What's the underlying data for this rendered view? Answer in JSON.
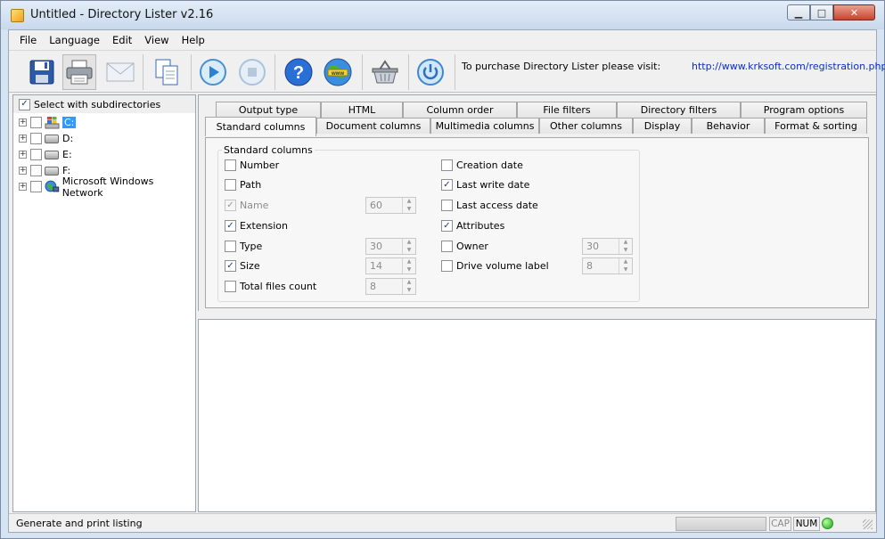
{
  "window": {
    "title": "Untitled - Directory Lister v2.16",
    "controls": {
      "minimize": "▁",
      "maximize": "□",
      "close": "✕"
    }
  },
  "menu": [
    "File",
    "Language",
    "Edit",
    "View",
    "Help"
  ],
  "toolbar": {
    "buttons": [
      {
        "name": "save",
        "icon": "floppy-disk-icon"
      },
      {
        "name": "print",
        "icon": "printer-icon"
      },
      {
        "name": "email",
        "icon": "envelope-icon"
      },
      {
        "name": "copy",
        "icon": "copy-pages-icon"
      },
      {
        "name": "start",
        "icon": "play-icon"
      },
      {
        "name": "stop",
        "icon": "stop-icon"
      },
      {
        "name": "help",
        "icon": "help-icon"
      },
      {
        "name": "website",
        "icon": "www-globe-icon"
      },
      {
        "name": "buy",
        "icon": "basket-icon"
      },
      {
        "name": "exit",
        "icon": "power-icon"
      }
    ],
    "purchase_text": "To purchase Directory Lister please visit:",
    "purchase_url": "http://www.krksoft.com/registration.php"
  },
  "tree": {
    "select_subdirs_label": "Select with subdirectories",
    "select_subdirs_checked": true,
    "items": [
      {
        "label": "C:",
        "icon": "windows-drive-icon",
        "selected": true
      },
      {
        "label": "D:",
        "icon": "drive-icon"
      },
      {
        "label": "E:",
        "icon": "drive-icon"
      },
      {
        "label": "F:",
        "icon": "drive-icon"
      },
      {
        "label": "Microsoft Windows Network",
        "icon": "network-icon"
      }
    ]
  },
  "tabs": {
    "row_back": [
      "Output type",
      "HTML",
      "Column order",
      "File filters",
      "Directory filters",
      "Program options"
    ],
    "row_front": [
      "Standard columns",
      "Document columns",
      "Multimedia columns",
      "Other columns",
      "Display",
      "Behavior",
      "Format & sorting"
    ],
    "active": "Standard columns"
  },
  "standard_columns": {
    "group_title": "Standard columns",
    "left": [
      {
        "label": "Number",
        "checked": false,
        "disabled": false
      },
      {
        "label": "Path",
        "checked": false,
        "disabled": false
      },
      {
        "label": "Name",
        "checked": true,
        "disabled": true,
        "width": "60"
      },
      {
        "label": "Extension",
        "checked": true,
        "disabled": false
      },
      {
        "label": "Type",
        "checked": false,
        "disabled": false,
        "width": "30"
      },
      {
        "label": "Size",
        "checked": true,
        "disabled": false,
        "width": "14"
      },
      {
        "label": "Total files count",
        "checked": false,
        "disabled": false,
        "width": "8"
      }
    ],
    "right": [
      {
        "label": "Creation date",
        "checked": false
      },
      {
        "label": "Last write date",
        "checked": true
      },
      {
        "label": "Last access date",
        "checked": false
      },
      {
        "label": "Attributes",
        "checked": true
      },
      {
        "label": "Owner",
        "checked": false,
        "width": "30"
      },
      {
        "label": "Drive volume label",
        "checked": false,
        "width": "8"
      }
    ]
  },
  "status": {
    "text": "Generate and print listing",
    "progress": 0,
    "cap": "CAP",
    "num": "NUM",
    "led_color": "#1f9e1f"
  }
}
